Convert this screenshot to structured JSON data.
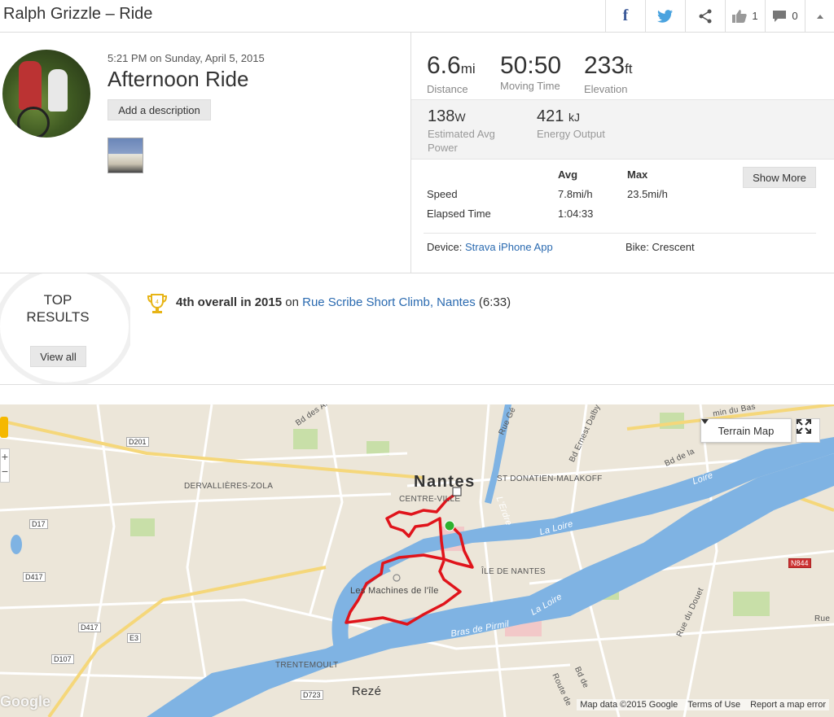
{
  "header": {
    "title": "Ralph Grizzle – Ride",
    "kudos_count": "1",
    "comments_count": "0"
  },
  "activity": {
    "date": "5:21 PM on Sunday, April 5, 2015",
    "name": "Afternoon Ride",
    "add_description": "Add a description"
  },
  "stats": {
    "distance": {
      "value": "6.6",
      "unit": "mi",
      "label": "Distance"
    },
    "moving_time": {
      "value": "50:50",
      "label": "Moving Time"
    },
    "elevation": {
      "value": "233",
      "unit": "ft",
      "label": "Elevation"
    },
    "power": {
      "value": "138",
      "unit": "W",
      "label_line1": "Estimated Avg",
      "label_line2": "Power"
    },
    "energy": {
      "value": "421",
      "unit": "kJ",
      "label": "Energy Output"
    }
  },
  "more_stats": {
    "col_avg": "Avg",
    "col_max": "Max",
    "show_more": "Show More",
    "rows": [
      {
        "label": "Speed",
        "avg": "7.8mi/h",
        "max": "23.5mi/h"
      },
      {
        "label": "Elapsed Time",
        "avg": "1:04:33",
        "max": ""
      }
    ],
    "device_label": "Device:",
    "device_value": "Strava iPhone App",
    "bike_label": "Bike:",
    "bike_value": "Crescent"
  },
  "top_results": {
    "title_line1": "TOP",
    "title_line2": "RESULTS",
    "view_all": "View all",
    "trophy_rank": "4",
    "achievement": "4th overall in 2015",
    "on": "on",
    "segment": "Rue Scribe Short Climb, Nantes",
    "time": "(6:33)"
  },
  "map": {
    "terrain_button": "Terrain Map",
    "attribution": "Map data ©2015 Google",
    "terms": "Terms of Use",
    "report": "Report a map error",
    "google_logo": "Google",
    "labels": {
      "nantes": "Nantes",
      "centre_ville": "CENTRE-VILLE",
      "st_donatien": "ST DONATIEN-MALAKOFF",
      "dervallieres": "DERVALLIÈRES-ZOLA",
      "ile_de_nantes": "ÎLE DE NANTES",
      "machines": "Les Machines de l'île",
      "trentemoult": "TRENTEMOULT",
      "reze": "Rezé",
      "la_loire_1": "La Loire",
      "la_loire_2": "La Loire",
      "loire": "Loire",
      "bras_de_pirmil": "Bras de Pirmil",
      "erdre": "L'Erdre",
      "bd_ernest_dalby": "Bd Ernest Dalby",
      "bd_de_la": "Bd de la",
      "rue_du_douet": "Rue du Douet",
      "rue": "Rue",
      "rue_ge": "Rue Gé",
      "bd_des_an": "Bd des An",
      "min_du_bas": "min du Bas",
      "route_de": "Route de",
      "bd_de": "Bd de"
    },
    "shields": {
      "d201": "D201",
      "d17": "D17",
      "d417a": "D417",
      "d417b": "D417",
      "e3": "E3",
      "d107": "D107",
      "d723": "D723",
      "n844": "N844"
    }
  }
}
